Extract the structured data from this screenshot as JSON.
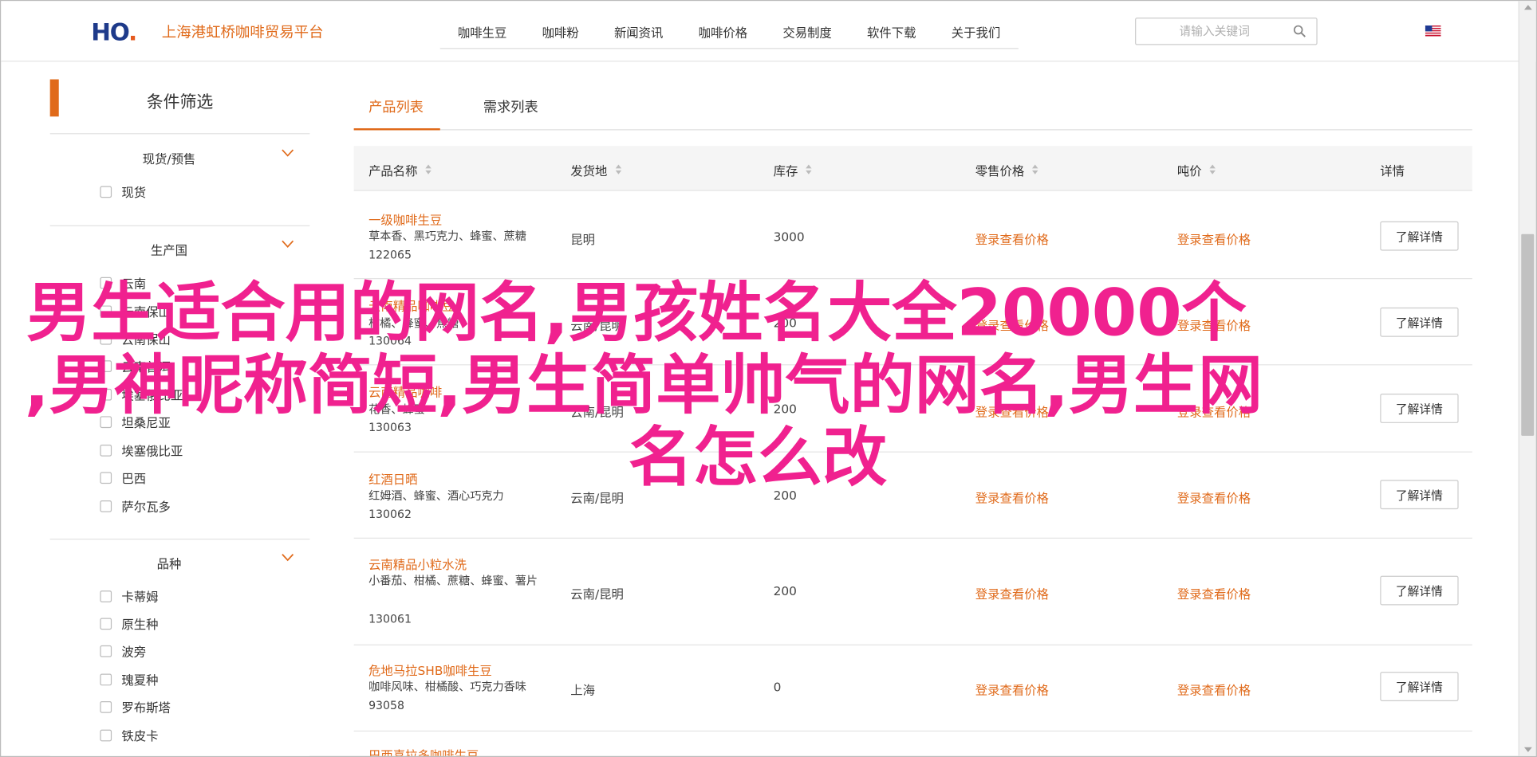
{
  "header": {
    "logo_text": "HO",
    "logo_dot": ".",
    "site_title": "上海港虹桥咖啡贸易平台",
    "nav": [
      "咖啡生豆",
      "咖啡粉",
      "新闻资讯",
      "咖啡价格",
      "交易制度",
      "软件下载",
      "关于我们"
    ],
    "search_placeholder": "请输入关键词",
    "search_icon": "search-icon",
    "language_icon": "us-flag-icon"
  },
  "sidebar": {
    "title": "条件筛选",
    "groups": [
      {
        "title": "现货/预售",
        "options": [
          "现货"
        ]
      },
      {
        "title": "生产国",
        "options": [
          "云南",
          "云南保山",
          "云南保山",
          "云南普洱",
          "埃塞俄比亚",
          "坦桑尼亚",
          "埃塞俄比亚",
          "巴西",
          "萨尔瓦多"
        ]
      },
      {
        "title": "品种",
        "options": [
          "卡蒂姆",
          "原生种",
          "波旁",
          "瑰夏种",
          "罗布斯塔",
          "铁皮卡"
        ]
      }
    ]
  },
  "tabs": [
    "产品列表",
    "需求列表"
  ],
  "table": {
    "columns": [
      "产品名称",
      "发货地",
      "库存",
      "零售价格",
      "吨价",
      "详情"
    ],
    "rows": [
      {
        "name": "一级咖啡生豆",
        "desc": "草本香、黑巧克力、蜂蜜、蔗糖",
        "id": "122065",
        "origin": "昆明",
        "stock": "3000",
        "retail": "登录查看价格",
        "ton": "登录查看价格",
        "action": "了解详情"
      },
      {
        "name": "云南精品咖啡豆",
        "desc": "柑橘、蜂蜜、焦糖",
        "id": "130064",
        "origin": "云南/昆明",
        "stock": "200",
        "retail": "登录查看价格",
        "ton": "登录查看价格",
        "action": "了解详情"
      },
      {
        "name": "云南精品咖啡",
        "desc": "花香、蜂蜜",
        "id": "130063",
        "origin": "云南/昆明",
        "stock": "200",
        "retail": "登录查看价格",
        "ton": "登录查看价格",
        "action": "了解详情"
      },
      {
        "name": "红酒日晒",
        "desc": "红姆酒、蜂蜜、酒心巧克力",
        "id": "130062",
        "origin": "云南/昆明",
        "stock": "200",
        "retail": "登录查看价格",
        "ton": "登录查看价格",
        "action": "了解详情"
      },
      {
        "name": "云南精品小粒水洗",
        "desc": "小番茄、柑橘、蔗糖、蜂蜜、薯片",
        "id": "130061",
        "origin": "云南/昆明",
        "stock": "200",
        "retail": "登录查看价格",
        "ton": "登录查看价格",
        "action": "了解详情"
      },
      {
        "name": "危地马拉SHB咖啡生豆",
        "desc": "咖啡风味、柑橘酸、巧克力香味",
        "id": "93058",
        "origin": "上海",
        "stock": "0",
        "retail": "登录查看价格",
        "ton": "登录查看价格",
        "action": "了解详情"
      },
      {
        "name": "巴西喜拉多咖啡生豆",
        "desc": "",
        "id": "",
        "origin": "",
        "stock": "",
        "retail": "",
        "ton": "",
        "action": ""
      }
    ]
  },
  "overlay": {
    "line1": "男生适合用的网名,男孩姓名大全20000个",
    "line2": ",男神昵称简短,男生简单帅气的网名,男生网",
    "line3": "名怎么改",
    "color": "#f0218f"
  },
  "colors": {
    "accent": "#e06a1a",
    "overlay": "#f0218f"
  }
}
